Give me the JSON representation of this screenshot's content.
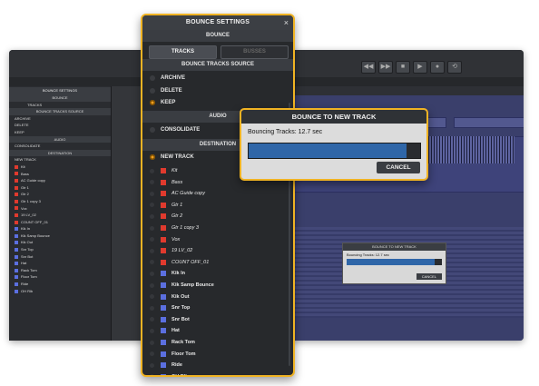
{
  "colors": {
    "accent": "#f0b323",
    "progress": "#2f66a8",
    "radio_on": "#f0a020"
  },
  "settings": {
    "title": "BOUNCE SETTINGS",
    "close": "×",
    "bounce_header": "BOUNCE",
    "tracks_button": "TRACKS",
    "busses_button": "BUSSES",
    "source_header": "BOUNCE TRACKS SOURCE",
    "source_options": [
      {
        "label": "ARCHIVE",
        "selected": false
      },
      {
        "label": "DELETE",
        "selected": false
      },
      {
        "label": "KEEP",
        "selected": true
      }
    ],
    "audio_header": "AUDIO",
    "consolidate": "CONSOLIDATE",
    "destination_header": "DESTINATION",
    "new_track": "NEW TRACK",
    "tracks": [
      {
        "name": "Kit",
        "color": "#e03a2e",
        "style": "i"
      },
      {
        "name": "Bass",
        "color": "#e03a2e",
        "style": "i"
      },
      {
        "name": "AC Guide copy",
        "color": "#e03a2e",
        "style": "i"
      },
      {
        "name": "Gtr 1",
        "color": "#e03a2e",
        "style": "i"
      },
      {
        "name": "Gtr 2",
        "color": "#e03a2e",
        "style": "i"
      },
      {
        "name": "Gtr 1 copy 3",
        "color": "#e03a2e",
        "style": "i"
      },
      {
        "name": "Vox",
        "color": "#e03a2e",
        "style": "i"
      },
      {
        "name": "19 LV_02",
        "color": "#e03a2e",
        "style": "i"
      },
      {
        "name": "COUNT OFF_01",
        "color": "#e03a2e",
        "style": "i"
      },
      {
        "name": "Kik In",
        "color": "#5b6fe0",
        "style": "b"
      },
      {
        "name": "Kik Samp Bounce",
        "color": "#5b6fe0",
        "style": "b"
      },
      {
        "name": "Kik Out",
        "color": "#5b6fe0",
        "style": "b"
      },
      {
        "name": "Snr Top",
        "color": "#5b6fe0",
        "style": "b"
      },
      {
        "name": "Snr Bot",
        "color": "#5b6fe0",
        "style": "b"
      },
      {
        "name": "Hat",
        "color": "#5b6fe0",
        "style": "b"
      },
      {
        "name": "Rack Tom",
        "color": "#5b6fe0",
        "style": "b"
      },
      {
        "name": "Floor Tom",
        "color": "#5b6fe0",
        "style": "b"
      },
      {
        "name": "Ride",
        "color": "#5b6fe0",
        "style": "b"
      },
      {
        "name": "OH Rlb",
        "color": "#5b6fe0",
        "style": "b"
      }
    ]
  },
  "dialog": {
    "title": "BOUNCE TO NEW TRACK",
    "status": "Bouncing Tracks: 12.7 sec",
    "progress": 0.92,
    "cancel": "CANCEL"
  }
}
